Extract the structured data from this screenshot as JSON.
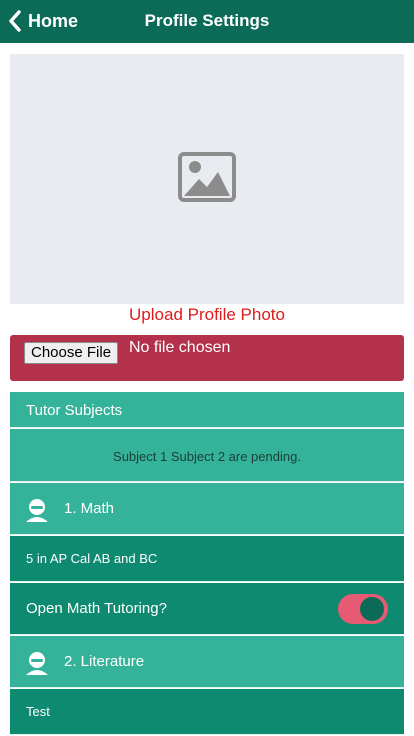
{
  "header": {
    "back_label": "Home",
    "title": "Profile Settings"
  },
  "photo": {
    "upload_label": "Upload Profile Photo"
  },
  "file_input": {
    "button_label": "Choose File",
    "status": "No file chosen"
  },
  "subjects": {
    "heading": "Tutor Subjects",
    "pending_text": "Subject 1 Subject 2 are pending.",
    "items": [
      {
        "label": "1. Math",
        "detail": "5 in AP Cal AB and BC",
        "toggle_label": "Open Math Tutoring?",
        "toggle_on": true
      },
      {
        "label": "2. Literature",
        "detail": "Test"
      }
    ]
  },
  "colors": {
    "header": "#0b6b57",
    "accent_light": "#35b39a",
    "accent_dark": "#0e8a70",
    "file_row": "#b3314a",
    "upload_link": "#e01b1b",
    "toggle_track": "#e65b73"
  },
  "icons": {
    "back": "chevron-left-icon",
    "photo_placeholder": "image-icon",
    "subject_avatar": "user-icon"
  }
}
